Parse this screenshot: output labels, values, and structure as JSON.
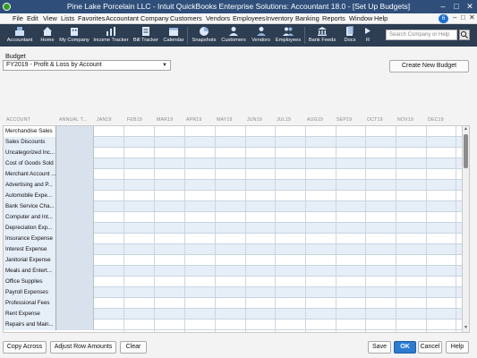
{
  "window": {
    "title": "Pine Lake Porcelain LLC  -  Intuit QuickBooks Enterprise Solutions: Accountant 18.0 - [Set Up Budgets]",
    "minimize": "–",
    "maximize": "□",
    "close": "✕"
  },
  "menubar": {
    "items": [
      "File",
      "Edit",
      "View",
      "Lists",
      "Favorites",
      "Accountant",
      "Company",
      "Customers",
      "Vendors",
      "Employees",
      "Inventory",
      "Banking",
      "Reports",
      "Window",
      "Help"
    ],
    "notification_count": "6",
    "doc_minimize": "–",
    "doc_restore": "□",
    "doc_close": "✕"
  },
  "toolbar": {
    "items": [
      {
        "label": "Accountant",
        "icon": "accountant-icon"
      },
      {
        "label": "Home",
        "icon": "home-icon"
      },
      {
        "label": "My Company",
        "icon": "my-company-icon"
      },
      {
        "label": "Income Tracker",
        "icon": "income-tracker-icon"
      },
      {
        "label": "Bill Tracker",
        "icon": "bill-tracker-icon"
      },
      {
        "label": "Calendar",
        "icon": "calendar-icon"
      },
      {
        "label": "Snapshots",
        "icon": "snapshots-icon"
      },
      {
        "label": "Customers",
        "icon": "customers-icon"
      },
      {
        "label": "Vendors",
        "icon": "vendors-icon"
      },
      {
        "label": "Employees",
        "icon": "employees-icon"
      },
      {
        "label": "Bank Feeds",
        "icon": "bank-feeds-icon"
      },
      {
        "label": "Docs",
        "icon": "docs-icon"
      },
      {
        "label": "R",
        "icon": "more-icon"
      }
    ],
    "search_placeholder": "Search Company or Help"
  },
  "budget": {
    "label": "Budget",
    "selected": "FY2019 - Profit & Loss by Account",
    "create_button": "Create New Budget"
  },
  "grid": {
    "columns": [
      "ACCOUNT",
      "ANNUAL T...",
      "JAN19",
      "FEB19",
      "MAR19",
      "APR19",
      "MAY19",
      "JUN19",
      "JUL19",
      "AUG19",
      "SEP19",
      "OCT19",
      "NOV19",
      "DEC19"
    ],
    "rows": [
      "Merchandise Sales",
      "Sales Discounts",
      "Uncategorized Inc...",
      "Cost of Goods Sold",
      "Merchant Account ...",
      "Advertising and P...",
      "Automobile Expe...",
      "Bank Service Cha...",
      "Computer and Int...",
      "Depreciation Exp...",
      "Insurance Expense",
      "Interest Expense",
      "Janitorial Expense",
      "Meals and Entert...",
      "Office Supplies",
      "Payroll Expenses",
      "Professional Fees",
      "Rent Expense",
      "Repairs and Main..."
    ]
  },
  "footer": {
    "copy_across": "Copy Across",
    "adjust_row_amounts": "Adjust Row Amounts",
    "clear": "Clear",
    "save": "Save",
    "ok": "OK",
    "cancel": "Cancel",
    "help": "Help"
  },
  "colors": {
    "title_bar": "#2f4f7a",
    "toolbar": "#2d3d52",
    "row_alt": "#e6eef8",
    "ok_button": "#2b7bd0"
  }
}
